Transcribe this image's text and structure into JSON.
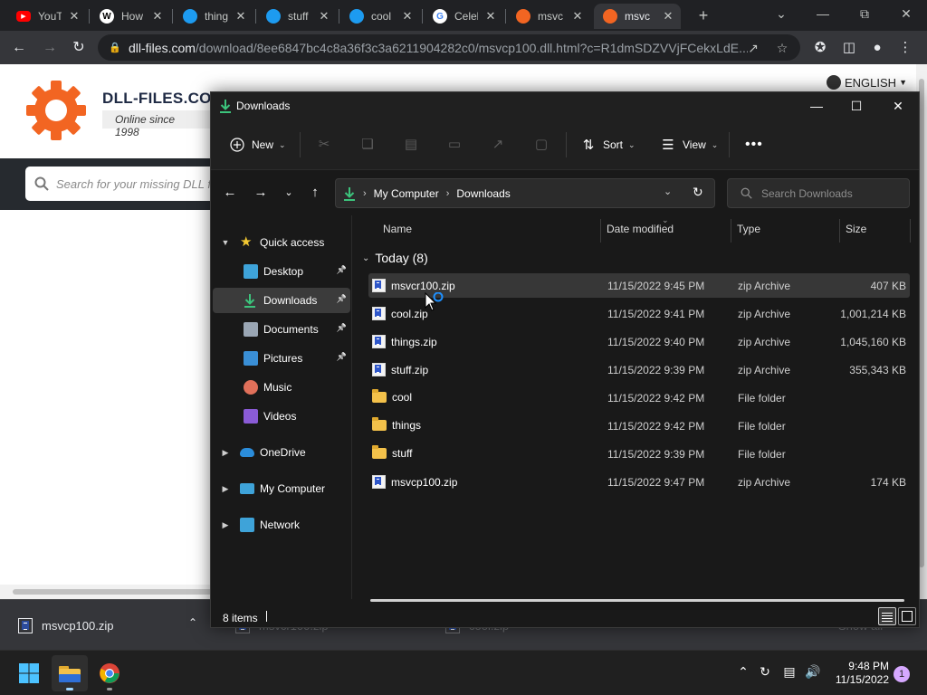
{
  "browser": {
    "tabs": [
      {
        "title": "YouTube",
        "display": "YouTu",
        "favicon": "youtube-icon",
        "color": "#ff0000"
      },
      {
        "title": "How",
        "display": "How",
        "favicon": "wiki-icon",
        "color": "#ffffff"
      },
      {
        "title": "thing",
        "display": "thing",
        "favicon": "bird-icon",
        "color": "#1d9bf0"
      },
      {
        "title": "stuff",
        "display": "stuff",
        "favicon": "bird-icon",
        "color": "#1d9bf0"
      },
      {
        "title": "cool",
        "display": "cool",
        "favicon": "bird-icon",
        "color": "#1d9bf0"
      },
      {
        "title": "Celeb",
        "display": "Celeb",
        "favicon": "google-icon",
        "color": "#ffffff"
      },
      {
        "title": "msvcp",
        "display": "msvc",
        "favicon": "gear-icon",
        "color": "#f26522"
      },
      {
        "title": "msvcp",
        "display": "msvc",
        "favicon": "gear-icon",
        "color": "#f26522",
        "active": true
      }
    ],
    "url_host": "dll-files.com",
    "url_path": "/download/8ee6847bc4c8a36f3c3a6211904282c0/msvcp100.dll.html?c=R1dmSDZVVjFCekxLdE..."
  },
  "website": {
    "brand": "DLL-FILES.COM",
    "tagline": "Online since 1998",
    "search_placeholder": "Search for your missing DLL fi",
    "language": "ENGLISH",
    "brand_color": "#f26522"
  },
  "downloads_bar": {
    "items": [
      "msvcp100.zip",
      "msvcr100.zip",
      "cool.zip"
    ],
    "show_all": "Show all"
  },
  "explorer": {
    "title": "Downloads",
    "commands": {
      "new": "New",
      "sort": "Sort",
      "view": "View"
    },
    "breadcrumb": [
      "My Computer",
      "Downloads"
    ],
    "search_placeholder": "Search Downloads",
    "sidebar": {
      "quick_access": "Quick access",
      "items": [
        {
          "label": "Desktop",
          "icon": "desktop-icon",
          "pinned": true
        },
        {
          "label": "Downloads",
          "icon": "download-icon",
          "pinned": true,
          "selected": true
        },
        {
          "label": "Documents",
          "icon": "documents-icon",
          "pinned": true
        },
        {
          "label": "Pictures",
          "icon": "pictures-icon",
          "pinned": true
        },
        {
          "label": "Music",
          "icon": "music-icon",
          "pinned": false
        },
        {
          "label": "Videos",
          "icon": "videos-icon",
          "pinned": false
        }
      ],
      "roots": [
        "OneDrive",
        "My Computer",
        "Network"
      ]
    },
    "columns": {
      "name": "Name",
      "date": "Date modified",
      "type": "Type",
      "size": "Size"
    },
    "group_label": "Today (8)",
    "files": [
      {
        "name": "msvcr100.zip",
        "date": "11/15/2022 9:45 PM",
        "type": "zip Archive",
        "size": "407 KB",
        "kind": "zip",
        "selected": true
      },
      {
        "name": "cool.zip",
        "date": "11/15/2022 9:41 PM",
        "type": "zip Archive",
        "size": "1,001,214 KB",
        "kind": "zip"
      },
      {
        "name": "things.zip",
        "date": "11/15/2022 9:40 PM",
        "type": "zip Archive",
        "size": "1,045,160 KB",
        "kind": "zip"
      },
      {
        "name": "stuff.zip",
        "date": "11/15/2022 9:39 PM",
        "type": "zip Archive",
        "size": "355,343 KB",
        "kind": "zip"
      },
      {
        "name": "cool",
        "date": "11/15/2022 9:42 PM",
        "type": "File folder",
        "size": "",
        "kind": "folder"
      },
      {
        "name": "things",
        "date": "11/15/2022 9:42 PM",
        "type": "File folder",
        "size": "",
        "kind": "folder"
      },
      {
        "name": "stuff",
        "date": "11/15/2022 9:39 PM",
        "type": "File folder",
        "size": "",
        "kind": "folder"
      },
      {
        "name": "msvcp100.zip",
        "date": "11/15/2022 9:47 PM",
        "type": "zip Archive",
        "size": "174 KB",
        "kind": "zip"
      }
    ],
    "status": "8 items"
  },
  "taskbar": {
    "time": "9:48 PM",
    "date": "11/15/2022",
    "notification_count": "1"
  }
}
